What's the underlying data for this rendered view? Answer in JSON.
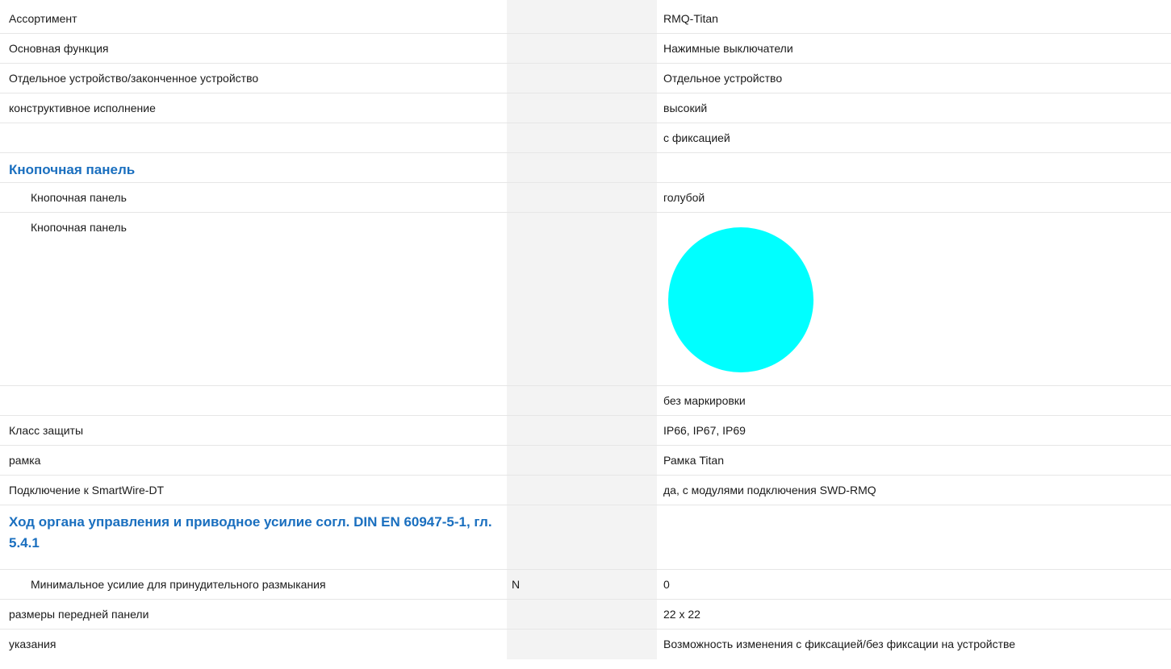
{
  "rows": {
    "assortment": {
      "label": "Ассортимент",
      "value": "RMQ-Titan"
    },
    "main_function": {
      "label": "Основная функция",
      "value": "Нажимные выключатели"
    },
    "device_type": {
      "label": "Отдельное устройство/законченное устройство",
      "value": "Отдельное устройство"
    },
    "design": {
      "label": "конструктивное исполнение",
      "value": "высокий"
    },
    "latching": {
      "label": "",
      "value": "с фиксацией"
    },
    "section_button_panel": {
      "label": "Кнопочная панель"
    },
    "button_panel_color": {
      "label": "Кнопочная панель",
      "value": "голубой"
    },
    "button_panel_swatch": {
      "label": "Кнопочная панель",
      "color": "#00ffff"
    },
    "marking": {
      "label": "",
      "value": "без маркировки"
    },
    "protection": {
      "label": "Класс защиты",
      "value": "IP66, IP67, IP69"
    },
    "frame": {
      "label": "рамка",
      "value": "Рамка Titan"
    },
    "smartwire": {
      "label": "Подключение к SmartWire-DT",
      "value": "да, с модулями подключения SWD-RMQ"
    },
    "section_travel": {
      "label": "Ход органа управления и приводное усилие согл. DIN EN 60947-5-1, гл. 5.4.1"
    },
    "min_force": {
      "label": "Минимальное усилие для принудительного размыкания",
      "unit": "N",
      "value": "0"
    },
    "front_dims": {
      "label": "размеры передней панели",
      "value": "22 x 22"
    },
    "notes": {
      "label": "указания",
      "value": "Возможность изменения с фиксацией/без фиксации на устройстве"
    }
  },
  "colors": {
    "heading": "#1a6fbf",
    "shaded_column": "#f3f3f3",
    "swatch": "#00ffff"
  }
}
